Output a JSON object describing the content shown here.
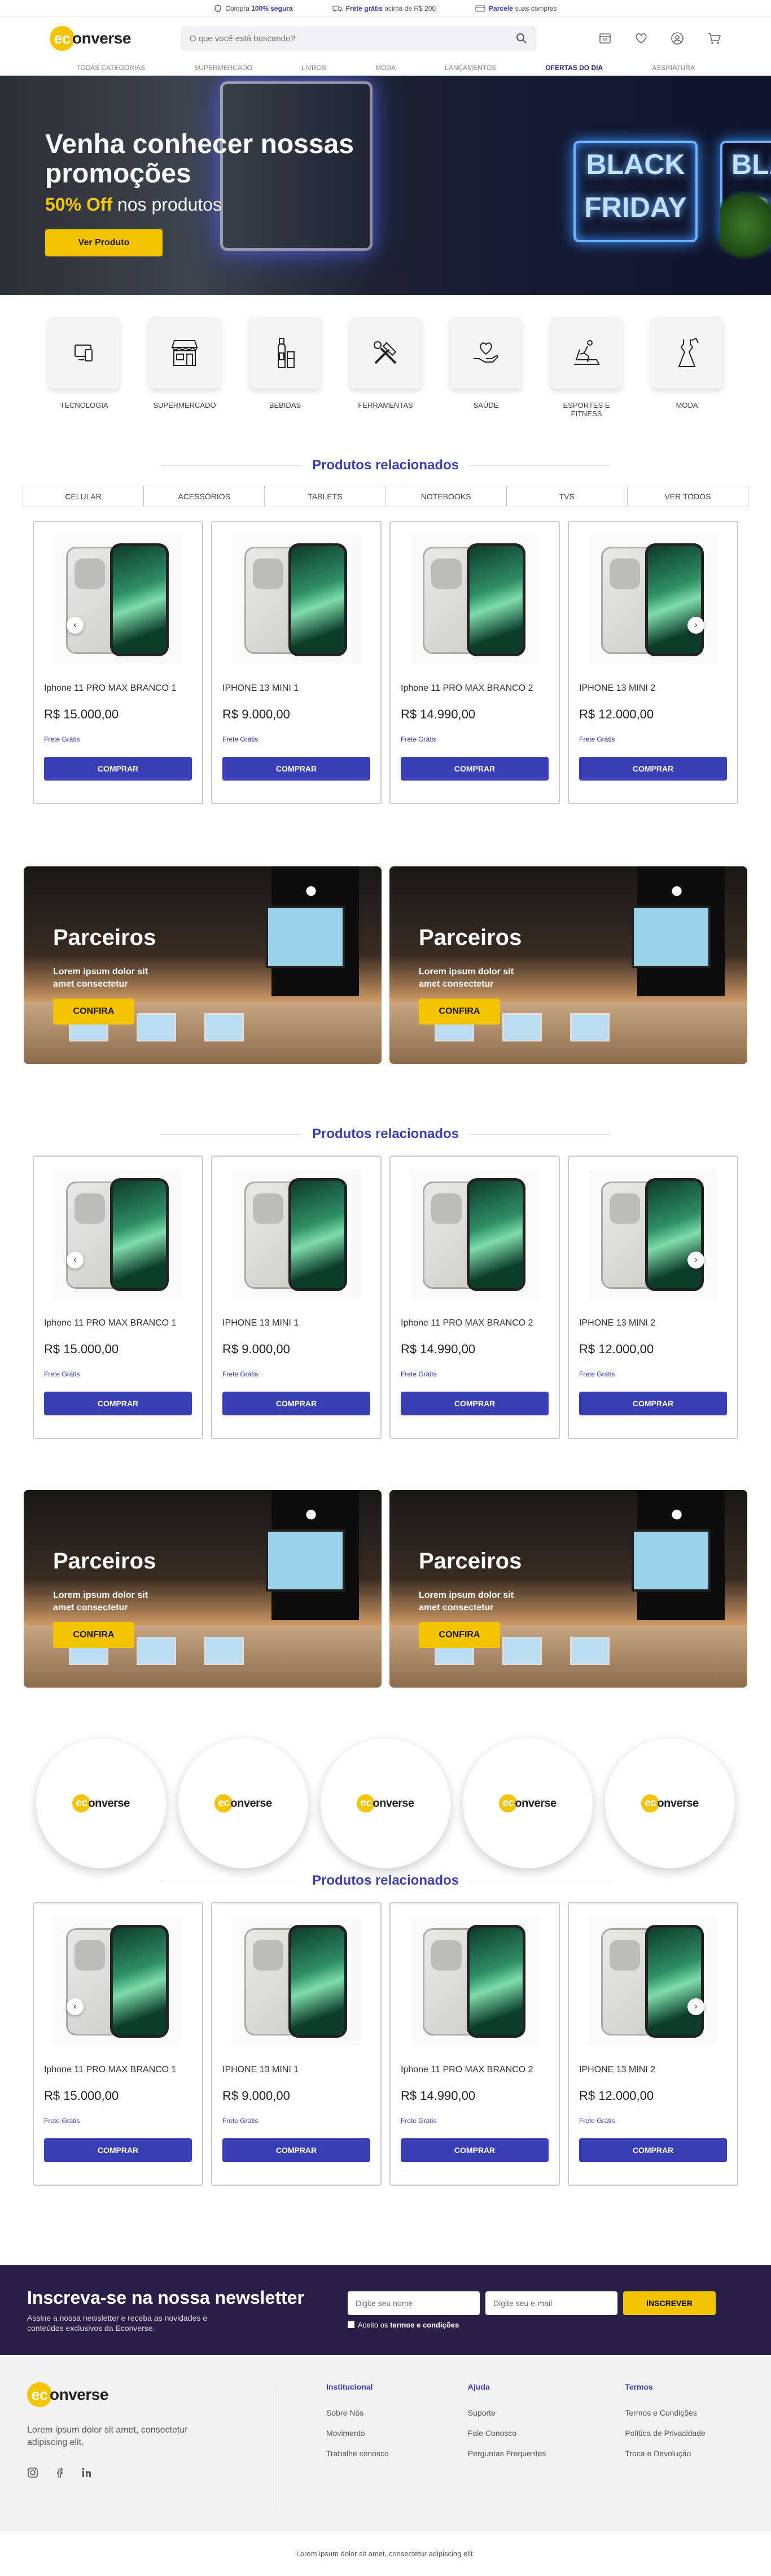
{
  "topbar": [
    {
      "icon": "shield-icon",
      "pre": "Compra ",
      "bold": "100% segura",
      "post": ""
    },
    {
      "icon": "truck-icon",
      "pre": "",
      "bold": "Frete grátis",
      "post": " acima de R$ 200"
    },
    {
      "icon": "card-icon",
      "pre": "",
      "bold": "Parcele",
      "post": " suas compras"
    }
  ],
  "header": {
    "logo_mark": "ec",
    "logo_text": "onverse",
    "search_placeholder": "O que você está buscando?"
  },
  "nav": [
    "TODAS CATEGORIAS",
    "SUPERMERCADO",
    "LIVROS",
    "MODA",
    "LANÇAMENTOS",
    "OFERTAS DO DIA",
    "ASSINATURA"
  ],
  "hero": {
    "title": "Venha conhecer nossas promoções",
    "sub_highlight": "50% Off",
    "sub_rest": " nos produtos",
    "button": "Ver Produto",
    "neon_text": "BLACK FRIDAY",
    "neon_text2": "BLA FRI"
  },
  "categories": [
    {
      "label": "TECNOLOGIA",
      "icon": "tech-icon"
    },
    {
      "label": "SUPERMERCADO",
      "icon": "store-icon"
    },
    {
      "label": "BEBIDAS",
      "icon": "bottle-icon"
    },
    {
      "label": "FERRAMENTAS",
      "icon": "tools-icon"
    },
    {
      "label": "SAÚDE",
      "icon": "health-icon"
    },
    {
      "label": "ESPORTES E FITNESS",
      "icon": "fitness-icon"
    },
    {
      "label": "MODA",
      "icon": "dress-icon"
    }
  ],
  "section_title": "Produtos relacionados",
  "tabs": [
    "CELULAR",
    "ACESSÓRIOS",
    "TABLETS",
    "NOTEBOOKS",
    "TVS",
    "VER TODOS"
  ],
  "products": [
    {
      "name": "Iphone 11 PRO MAX BRANCO 1",
      "price": "R$ 15.000,00",
      "shipping": "Frete Grátis",
      "button": "COMPRAR"
    },
    {
      "name": "IPHONE 13 MINI 1",
      "price": "R$ 9.000,00",
      "shipping": "Frete Grátis",
      "button": "COMPRAR"
    },
    {
      "name": "Iphone 11 PRO MAX BRANCO 2",
      "price": "R$ 14.990,00",
      "shipping": "Frete Grátis",
      "button": "COMPRAR"
    },
    {
      "name": "IPHONE 13 MINI 2",
      "price": "R$ 12.000,00",
      "shipping": "Frete Grátis",
      "button": "COMPRAR"
    }
  ],
  "banner": {
    "title": "Parceiros",
    "text": "Lorem ipsum dolor sit amet consectetur",
    "button": "CONFIRA"
  },
  "brands_count_label": "",
  "brand": {
    "logo_mark": "ec",
    "logo_text": "onverse"
  },
  "newsletter": {
    "title": "Inscreva-se na nossa newsletter",
    "text": "Assine a nossa newsletter e receba as novidades e conteúdos exclusivos da Econverse.",
    "name_placeholder": "Digite seu nome",
    "email_placeholder": "Digite seu e-mail",
    "button": "INSCREVER",
    "terms_pre": "Aceito os ",
    "terms_link": "termos e condições"
  },
  "footer": {
    "logo_mark": "ec",
    "logo_text": "onverse",
    "about": "Lorem ipsum dolor sit amet, consectetur adipiscing elit.",
    "cols": [
      {
        "title": "Institucional",
        "links": [
          "Sobre Nós",
          "Movimento",
          "Trabalhe conosco"
        ]
      },
      {
        "title": "Ajuda",
        "links": [
          "Suporte",
          "Fale Conosco",
          "Perguntas Frequentes"
        ]
      },
      {
        "title": "Termos",
        "links": [
          "Termos e Condições",
          "Política de Privacidade",
          "Troca e Devolução"
        ]
      }
    ],
    "copyright": "Lorem ipsum dolor sit amet, consectetur adipiscing elit."
  }
}
